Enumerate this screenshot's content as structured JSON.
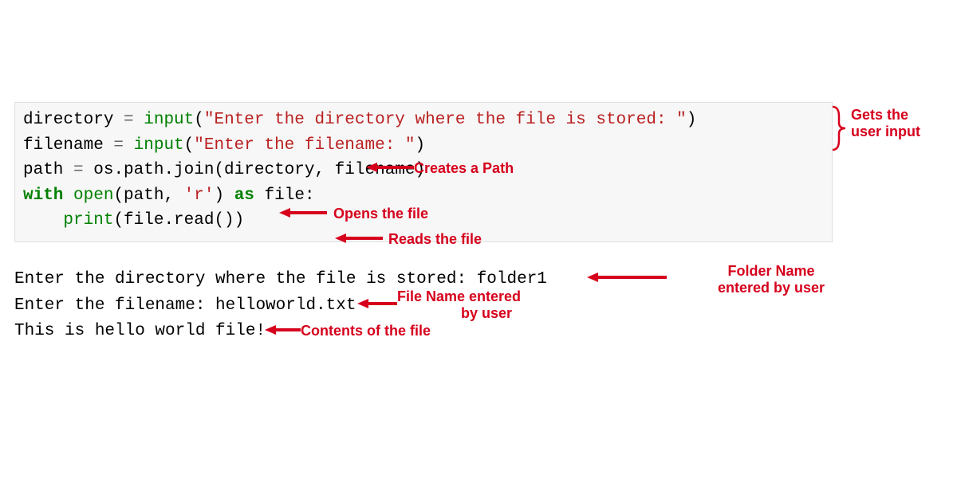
{
  "code": {
    "line1": {
      "var": "directory",
      "eq": " = ",
      "fn": "input",
      "open": "(",
      "str": "\"Enter the directory where the file is stored: \"",
      "close": ")"
    },
    "line2": {
      "var": "filename",
      "eq": " = ",
      "fn": "input",
      "open": "(",
      "str": "\"Enter the filename: \"",
      "close": ")"
    },
    "line3": {
      "var": "path",
      "eq": " = ",
      "call": "os.path.join(directory, filename)"
    },
    "line4": "",
    "line5": {
      "kw1": "with",
      "sp1": " ",
      "fn": "open",
      "args": "(path, ",
      "str": "'r'",
      "close": ")",
      "sp2": " ",
      "kw2": "as",
      "rest": " file:"
    },
    "line6": {
      "indent": "    ",
      "fn": "print",
      "args": "(file.read())"
    }
  },
  "output": {
    "line1": "Enter the directory where the file is stored: folder1",
    "line2": "Enter the filename: helloworld.txt",
    "line3": "This is hello world file!"
  },
  "annotations": {
    "a1": "Gets the",
    "a1b": "user input",
    "a2": "Creates a Path",
    "a3": "Opens the file",
    "a4": "Reads the file",
    "a5": "Folder Name",
    "a5b": "entered by user",
    "a6": "File Name entered",
    "a6b": "by user",
    "a7": "Contents of the file"
  }
}
